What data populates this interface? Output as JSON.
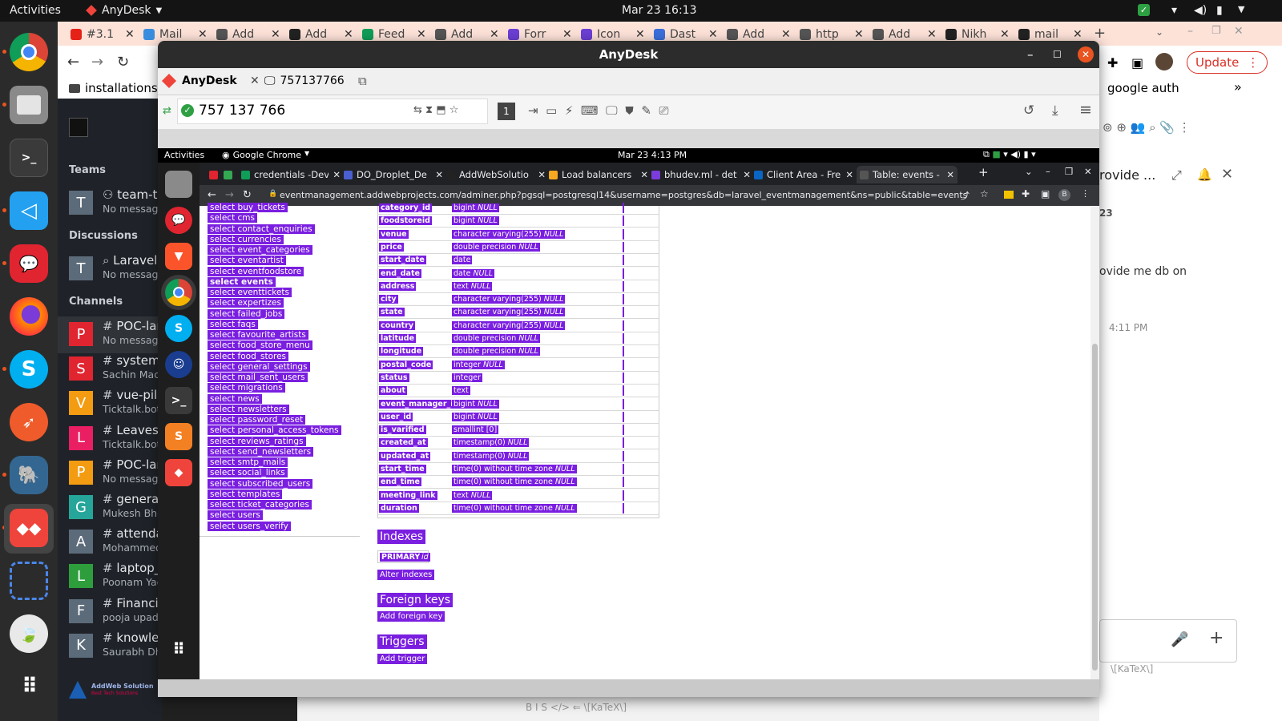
{
  "topbar": {
    "activities": "Activities",
    "app_menu": "AnyDesk",
    "clock": "Mar 23  16:13"
  },
  "outer_browser": {
    "tabs": [
      {
        "label": "#3.1",
        "color": "#e62117"
      },
      {
        "label": "Mail",
        "color": "#3a8dde"
      },
      {
        "label": "Add",
        "color": "#555555"
      },
      {
        "label": "Add",
        "color": "#222222"
      },
      {
        "label": "Feed",
        "color": "#0f9d58"
      },
      {
        "label": "Add",
        "color": "#555555"
      },
      {
        "label": "Forr",
        "color": "#6b3fd4"
      },
      {
        "label": "Icon",
        "color": "#6b3fd4"
      },
      {
        "label": "Dast",
        "color": "#3b6edc"
      },
      {
        "label": "Add",
        "color": "#555555"
      },
      {
        "label": "http",
        "color": "#555555"
      },
      {
        "label": "Add",
        "color": "#555555"
      },
      {
        "label": "Nikh",
        "color": "#222222"
      },
      {
        "label": "mail",
        "color": "#222222"
      }
    ],
    "bookmark_left": "installations",
    "bookmark_right": "google auth",
    "update_label": "Update"
  },
  "rocketchat": {
    "sections": {
      "teams": "Teams",
      "discussions": "Discussions",
      "channels": "Channels"
    },
    "teams": [
      {
        "initial": "T",
        "name": "team-te",
        "sub": "No message",
        "color": "#5c6b7a",
        "icon": "team-icon"
      }
    ],
    "discussions": [
      {
        "initial": "T",
        "name": "Laravel",
        "sub": "No message",
        "color": "#5c6b7a",
        "icon": "discussion-icon"
      }
    ],
    "channels": [
      {
        "initial": "P",
        "name": "POC-lar",
        "sub": "No message",
        "color": "#e02530"
      },
      {
        "initial": "S",
        "name": "system",
        "sub": "Sachin Macw",
        "color": "#e02530"
      },
      {
        "initial": "V",
        "name": "vue-pilo",
        "sub": "Ticktalk.bot:",
        "color": "#f39c12"
      },
      {
        "initial": "L",
        "name": "Leaves-",
        "sub": "Ticktalk.bot:",
        "color": "#e91e63"
      },
      {
        "initial": "P",
        "name": "POC-lar",
        "sub": "No message",
        "color": "#f39c12"
      },
      {
        "initial": "G",
        "name": "general",
        "sub": "Mukesh Bhe",
        "color": "#26a69a"
      },
      {
        "initial": "A",
        "name": "attenda",
        "sub": "Mohammed",
        "color": "#5c6b7a"
      },
      {
        "initial": "L",
        "name": "laptop_",
        "sub": "Poonam Yad",
        "color": "#2e9e3d"
      },
      {
        "initial": "F",
        "name": "Financia",
        "sub": "pooja upadh",
        "color": "#5c6b7a"
      },
      {
        "initial": "K",
        "name": "knowle",
        "sub": "Saurabh Dha",
        "color": "#5c6b7a"
      }
    ],
    "brand": "AddWeb Solution",
    "brand_tag": "Best Tech Solutions",
    "right_panel": {
      "title": "rovide ...",
      "date": "23",
      "message": "ovide me db on",
      "time": "4:11 PM",
      "composer_hint": "\\[KaTeX\\]",
      "bottom_toolbar": "B  I  S  </>  ⇐  \\[KaTeX\\]"
    }
  },
  "anydesk": {
    "title": "AnyDesk",
    "tab_home": "AnyDesk",
    "tab_session": "757137766",
    "address": "757 137 766",
    "remote": {
      "topbar": {
        "activities": "Activities",
        "app": "Google Chrome",
        "clock": "Mar 23  4:13 PM"
      },
      "tabs": [
        {
          "label": "",
          "color": "#e02530"
        },
        {
          "label": "",
          "color": "#34a853"
        },
        {
          "label": "credentials -Dev",
          "color": "#0f9d58"
        },
        {
          "label": "DO_Droplet_De",
          "color": "#4a5fd0"
        },
        {
          "label": "AddWebSolutio",
          "color": "#222222"
        },
        {
          "label": "Load balancers",
          "color": "#f6a821"
        },
        {
          "label": "bhudev.ml - det",
          "color": "#7a3cdb"
        },
        {
          "label": "Client Area - Fre",
          "color": "#0a66c2"
        },
        {
          "label": "Table: events - p",
          "color": "#555555"
        }
      ],
      "url": "eventmanagement.addwebprojects.com/adminer.php?pgsql=postgresql14&username=postgres&db=laravel_eventmanagement&ns=public&table=events",
      "profile": "B",
      "left_links": [
        "select buy_tickets",
        "select cms",
        "select contact_enquiries",
        "select currencies",
        "select event_categories",
        "select eventartist",
        "select eventfoodstore",
        "select events",
        "select eventtickets",
        "select expertizes",
        "select failed_jobs",
        "select faqs",
        "select favourite_artists",
        "select food_store_menu",
        "select food_stores",
        "select general_settings",
        "select mail_sent_users",
        "select migrations",
        "select news",
        "select newsletters",
        "select password_reset",
        "select personal_access_tokens",
        "select reviews_ratings",
        "select send_newsletters",
        "select smtp_mails",
        "select social_links",
        "select subscribed_users",
        "select templates",
        "select ticket_categories",
        "select users",
        "select users_verify"
      ],
      "columns": [
        {
          "name": "category_id",
          "type": "bigint",
          "null": "NULL"
        },
        {
          "name": "foodstoreid",
          "type": "bigint",
          "null": "NULL"
        },
        {
          "name": "venue",
          "type": "character varying(255)",
          "null": "NULL"
        },
        {
          "name": "price",
          "type": "double precision",
          "null": "NULL"
        },
        {
          "name": "start_date",
          "type": "date",
          "null": ""
        },
        {
          "name": "end_date",
          "type": "date",
          "null": "NULL"
        },
        {
          "name": "address",
          "type": "text",
          "null": "NULL"
        },
        {
          "name": "city",
          "type": "character varying(255)",
          "null": "NULL"
        },
        {
          "name": "state",
          "type": "character varying(255)",
          "null": "NULL"
        },
        {
          "name": "country",
          "type": "character varying(255)",
          "null": "NULL"
        },
        {
          "name": "latitude",
          "type": "double precision",
          "null": "NULL"
        },
        {
          "name": "longitude",
          "type": "double precision",
          "null": "NULL"
        },
        {
          "name": "postal_code",
          "type": "integer",
          "null": "NULL"
        },
        {
          "name": "status",
          "type": "integer",
          "null": ""
        },
        {
          "name": "about",
          "type": "text",
          "null": ""
        },
        {
          "name": "event_manager_id",
          "type": "bigint",
          "null": "NULL"
        },
        {
          "name": "user_id",
          "type": "bigint",
          "null": "NULL"
        },
        {
          "name": "is_varified",
          "type": "smallint [0]",
          "null": ""
        },
        {
          "name": "created_at",
          "type": "timestamp(0)",
          "null": "NULL"
        },
        {
          "name": "updated_at",
          "type": "timestamp(0)",
          "null": "NULL"
        },
        {
          "name": "start_time",
          "type": "time(0) without time zone",
          "null": "NULL"
        },
        {
          "name": "end_time",
          "type": "time(0) without time zone",
          "null": "NULL"
        },
        {
          "name": "meeting_link",
          "type": "text",
          "null": "NULL"
        },
        {
          "name": "duration",
          "type": "time(0) without time zone",
          "null": "NULL"
        }
      ],
      "indexes_heading": "Indexes",
      "index_primary": "PRIMARY",
      "index_col": "id",
      "alter_indexes": "Alter indexes",
      "foreign_heading": "Foreign keys",
      "add_foreign": "Add foreign key",
      "triggers_heading": "Triggers",
      "add_trigger": "Add trigger"
    }
  }
}
